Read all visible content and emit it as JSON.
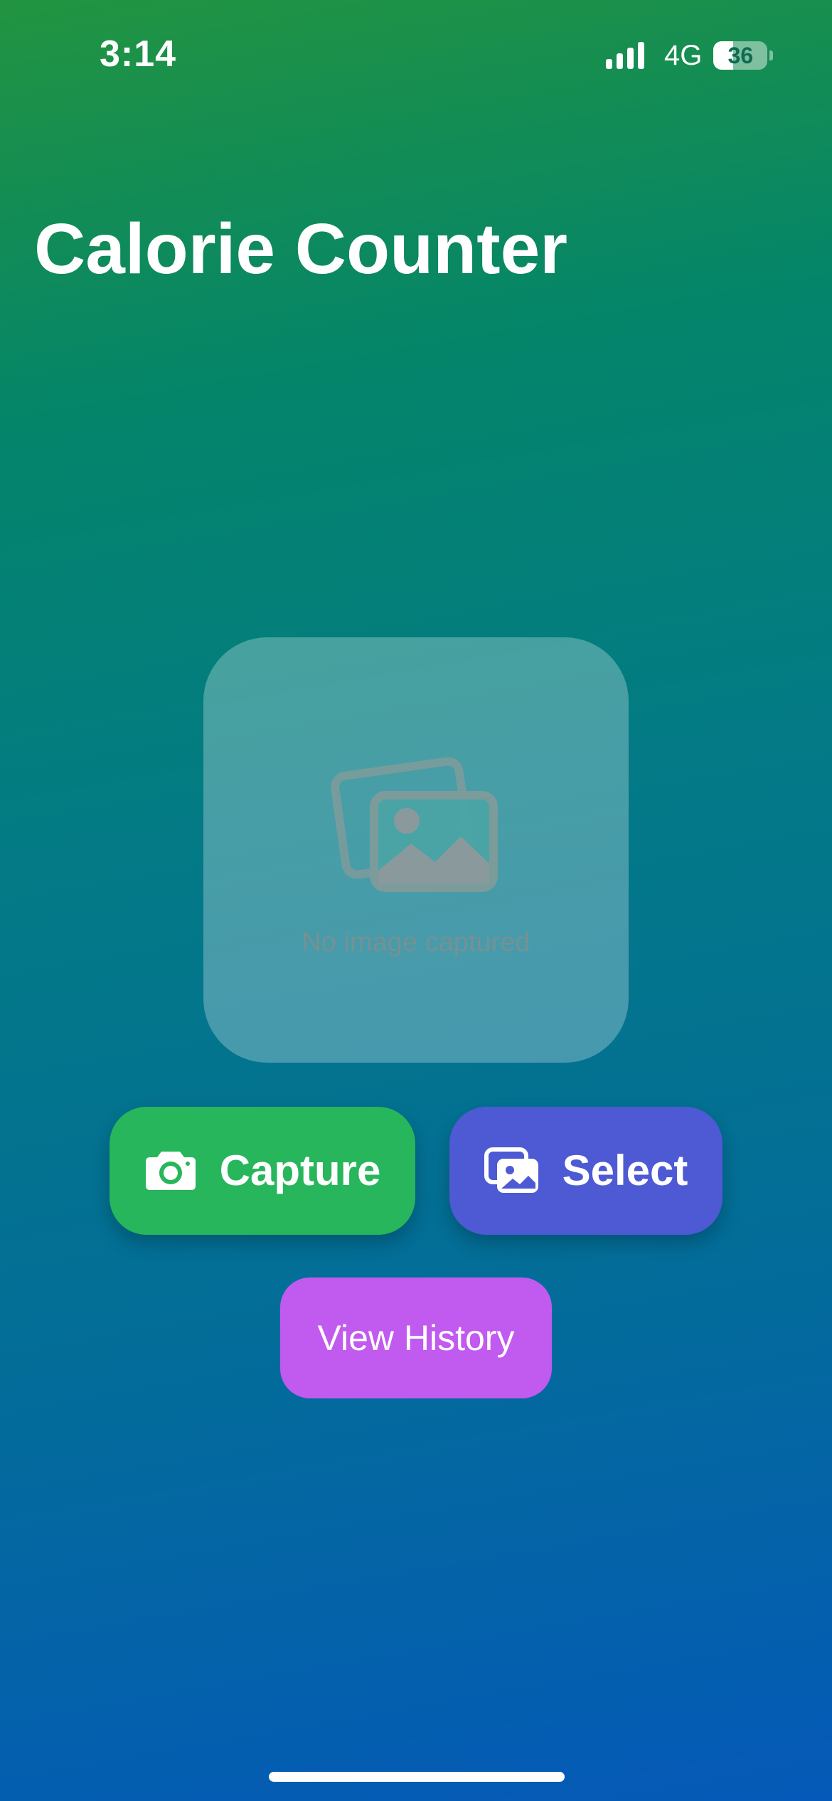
{
  "status_bar": {
    "time": "3:14",
    "network": "4G",
    "battery_level": "36",
    "signal_icon": "cellular-signal-icon",
    "battery_icon": "battery-icon"
  },
  "header": {
    "title": "Calorie Counter"
  },
  "image_preview": {
    "icon": "photo-stack-icon",
    "placeholder_text": "No image captured"
  },
  "actions": {
    "capture": {
      "label": "Capture",
      "icon": "camera-icon",
      "color": "#27b65b"
    },
    "select": {
      "label": "Select",
      "icon": "photo-library-icon",
      "color": "#4d5ad4"
    },
    "history": {
      "label": "View History",
      "color": "#c15aee"
    }
  },
  "colors": {
    "background_top": "#229440",
    "background_bottom": "#0559b8"
  }
}
